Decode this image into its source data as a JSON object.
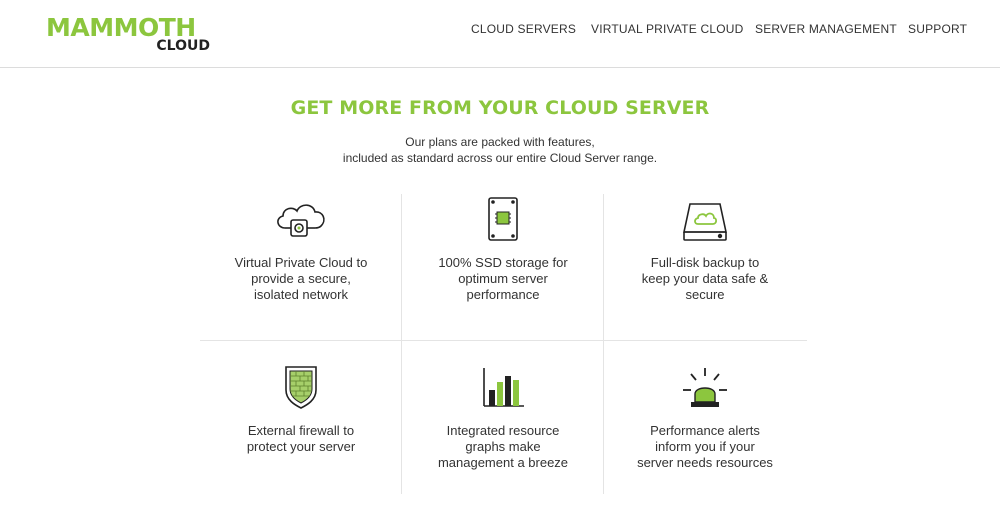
{
  "header": {
    "logo": {
      "main": "MAMMOTH",
      "sub": "CLOUD"
    },
    "nav": [
      {
        "label": "CLOUD SERVERS"
      },
      {
        "label": "VIRTUAL PRIVATE CLOUD"
      },
      {
        "label": "SERVER MANAGEMENT"
      },
      {
        "label": "SUPPORT"
      }
    ]
  },
  "hero": {
    "title": "GET MORE FROM YOUR CLOUD SERVER",
    "subtitle_line1": "Our plans are packed with features,",
    "subtitle_line2": "included as standard across our entire Cloud Server range."
  },
  "features": [
    {
      "icon": "cloud-network-icon",
      "lines": [
        "Virtual Private Cloud to",
        "provide a secure,",
        "isolated network"
      ]
    },
    {
      "icon": "ssd-drive-icon",
      "lines": [
        "100% SSD storage for",
        "optimum server",
        "performance"
      ]
    },
    {
      "icon": "backup-drive-icon",
      "lines": [
        "Full-disk backup to",
        "keep your data safe &",
        "secure"
      ]
    },
    {
      "icon": "firewall-shield-icon",
      "lines": [
        "External firewall to",
        "protect your server"
      ]
    },
    {
      "icon": "bar-graph-icon",
      "lines": [
        "Integrated resource",
        "graphs make",
        "management a breeze"
      ]
    },
    {
      "icon": "alert-beacon-icon",
      "lines": [
        "Performance alerts",
        "inform you if your",
        "server needs resources"
      ]
    }
  ],
  "colors": {
    "brand_green": "#8cc63e",
    "text": "#333333",
    "divider": "#e4e4e4"
  }
}
